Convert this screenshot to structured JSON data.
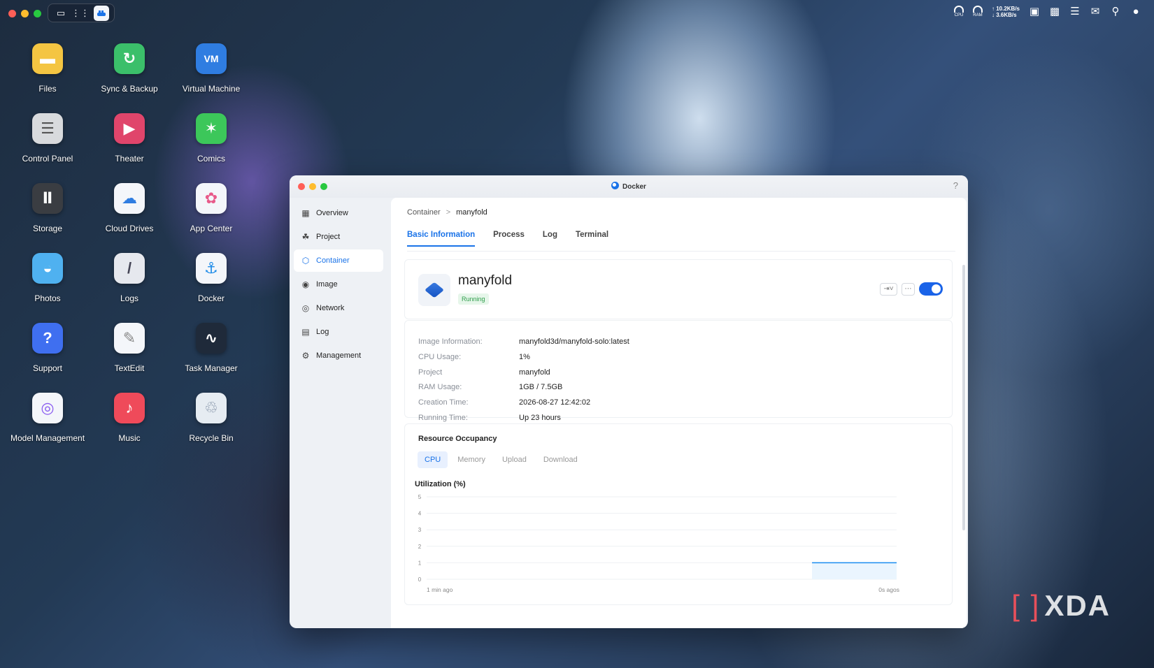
{
  "topbar": {
    "net_up": "↑ 10.2KB/s",
    "net_down": "↓ 3.6KB/s",
    "cpu_label": "CPU",
    "ram_label": "RAM"
  },
  "desktop": {
    "icons": [
      {
        "label": "Files",
        "icon": "folder-icon",
        "color": "#f4c542"
      },
      {
        "label": "Sync & Backup",
        "icon": "sync-icon",
        "color": "#3bbf6a"
      },
      {
        "label": "Virtual Machine",
        "icon": "vm-icon",
        "color": "#2f7de1"
      },
      {
        "label": "Control Panel",
        "icon": "control-panel-icon",
        "color": "#d8dadd"
      },
      {
        "label": "Theater",
        "icon": "theater-icon",
        "color": "#e0456b"
      },
      {
        "label": "Comics",
        "icon": "comics-icon",
        "color": "#3cc75a"
      },
      {
        "label": "Storage",
        "icon": "storage-icon",
        "color": "#3a3d42"
      },
      {
        "label": "Cloud Drives",
        "icon": "cloud-drives-icon",
        "color": "#f4f6fa"
      },
      {
        "label": "App Center",
        "icon": "app-center-icon",
        "color": "#f4f6fa"
      },
      {
        "label": "Photos",
        "icon": "photos-icon",
        "color": "#4fb1f0"
      },
      {
        "label": "Logs",
        "icon": "logs-icon",
        "color": "#e6e8ee"
      },
      {
        "label": "Docker",
        "icon": "docker-icon",
        "color": "#f4f6fa"
      },
      {
        "label": "Support",
        "icon": "support-icon",
        "color": "#3f6ff0"
      },
      {
        "label": "TextEdit",
        "icon": "textedit-icon",
        "color": "#f4f6fa"
      },
      {
        "label": "Task Manager",
        "icon": "task-manager-icon",
        "color": "#1f2a3a"
      },
      {
        "label": "Model Management",
        "icon": "model-management-icon",
        "color": "#f4f6fa"
      },
      {
        "label": "Music",
        "icon": "music-icon",
        "color": "#ef4a5a"
      },
      {
        "label": "Recycle Bin",
        "icon": "recycle-bin-icon",
        "color": "#e6ecf2"
      }
    ]
  },
  "window": {
    "title": "Docker",
    "help": "?",
    "sidebar": [
      {
        "label": "Overview",
        "icon": "grid-icon",
        "active": false
      },
      {
        "label": "Project",
        "icon": "project-icon",
        "active": false
      },
      {
        "label": "Container",
        "icon": "cube-icon",
        "active": true
      },
      {
        "label": "Image",
        "icon": "image-icon",
        "active": false
      },
      {
        "label": "Network",
        "icon": "globe-icon",
        "active": false
      },
      {
        "label": "Log",
        "icon": "log-icon",
        "active": false
      },
      {
        "label": "Management",
        "icon": "gear-icon",
        "active": false
      }
    ],
    "breadcrumb": {
      "root": "Container",
      "sep": ">",
      "current": "manyfold"
    },
    "tabs": [
      "Basic Information",
      "Process",
      "Log",
      "Terminal"
    ],
    "container": {
      "name": "manyfold",
      "status": "Running",
      "enabled": true
    },
    "info": [
      {
        "key": "Image Information:",
        "value": "manyfold3d/manyfold-solo:latest"
      },
      {
        "key": "CPU Usage:",
        "value": "1%"
      },
      {
        "key": "Project",
        "value": "manyfold"
      },
      {
        "key": "RAM Usage:",
        "value": "1GB / 7.5GB"
      },
      {
        "key": "Creation Time:",
        "value": "2026-08-27 12:42:02"
      },
      {
        "key": "Running Time:",
        "value": "Up 23 hours"
      }
    ],
    "resource": {
      "title": "Resource Occupancy",
      "tabs": [
        "CPU",
        "Memory",
        "Upload",
        "Download"
      ],
      "active_tab": "CPU",
      "util_label": "Utilization (%)"
    }
  },
  "chart_data": {
    "type": "area",
    "ylabel": "Utilization (%)",
    "ylim": [
      0,
      5
    ],
    "yticks": [
      0,
      1,
      2,
      3,
      4,
      5
    ],
    "xtick_labels": [
      "1 min ago",
      "0s agos"
    ],
    "x_fraction_range": [
      0.0,
      1.0
    ],
    "series": [
      {
        "x_start_fraction": 0.82,
        "x_end_fraction": 1.0,
        "values": [
          1,
          1
        ],
        "color": "#1a8cf0"
      }
    ]
  },
  "watermark": {
    "text": "XDA",
    "bracket": "[ ]"
  }
}
